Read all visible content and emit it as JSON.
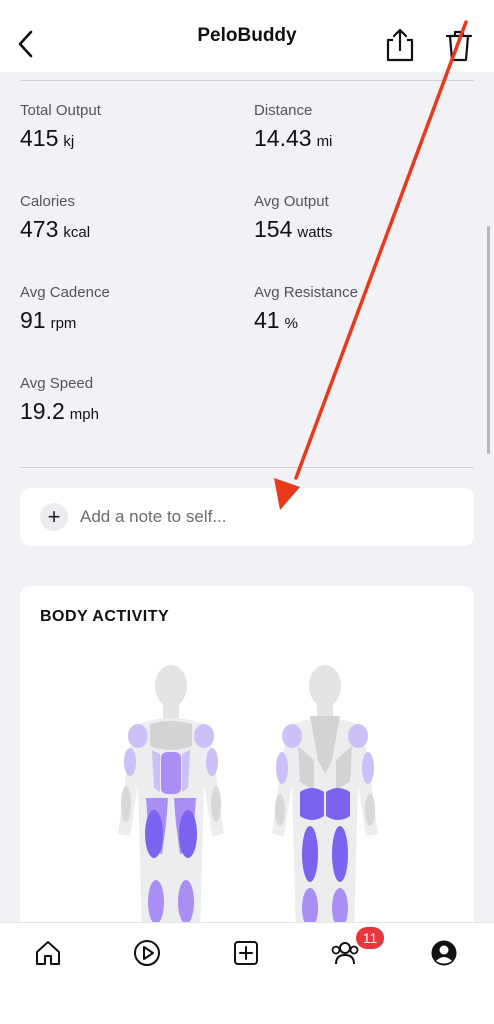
{
  "nav": {
    "title": "PeloBuddy"
  },
  "stats": [
    {
      "label": "Total Output",
      "value": "415",
      "unit": "kj"
    },
    {
      "label": "Distance",
      "value": "14.43",
      "unit": "mi"
    },
    {
      "label": "Calories",
      "value": "473",
      "unit": "kcal"
    },
    {
      "label": "Avg Output",
      "value": "154",
      "unit": "watts"
    },
    {
      "label": "Avg Cadence",
      "value": "91",
      "unit": "rpm"
    },
    {
      "label": "Avg Resistance",
      "value": "41",
      "unit": "%"
    },
    {
      "label": "Avg Speed",
      "value": "19.2",
      "unit": "mph"
    }
  ],
  "note": {
    "placeholder": "Add a note to self..."
  },
  "body_activity": {
    "title": "BODY ACTIVITY"
  },
  "tabbar": {
    "community_badge": "11"
  },
  "colors": {
    "background": "#f2f1f6",
    "muscle_strong": "#7b63f0",
    "muscle_medium": "#a98ef3",
    "muscle_light": "#cdbff8",
    "badge": "#e8363e",
    "annotation_arrow": "#e8391d"
  },
  "icons": {
    "back": "chevron-left-icon",
    "share": "share-icon",
    "trash": "trash-icon",
    "home": "home-icon",
    "play": "play-icon",
    "add": "plus-square-icon",
    "community": "people-icon",
    "profile": "profile-icon"
  }
}
